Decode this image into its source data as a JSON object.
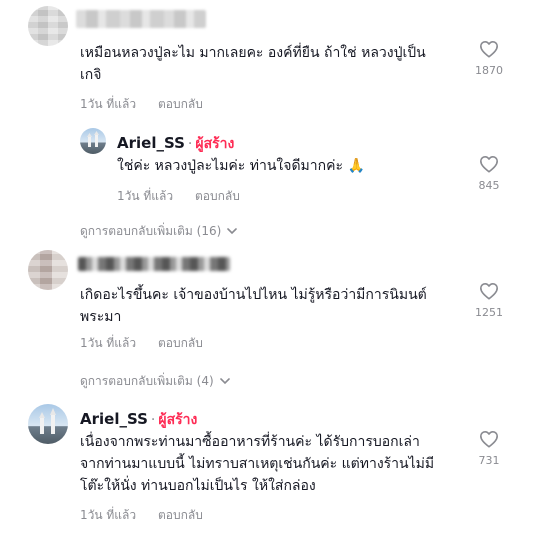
{
  "comments": [
    {
      "author": "",
      "text_lines": [
        "เหมือนหลวงปู่ละไม มากเลยคะ องค์ที่ยืน ถ้าใช่ หลวงปู่เป็น",
        "เกจิ"
      ],
      "time": "1วัน ที่แล้ว",
      "reply_label": "ตอบกลับ",
      "likes": "1870",
      "reply": {
        "author": "Ariel_SS",
        "dot": "·",
        "creator_label": "ผู้สร้าง",
        "text": "ใช่ค่ะ หลวงปู่ละไมค่ะ ท่านใจดีมากค่ะ 🙏",
        "time": "1วัน ที่แล้ว",
        "reply_label": "ตอบกลับ",
        "likes": "845"
      },
      "more_replies": "ดูการตอบกลับเพิ่มเติม (16)"
    },
    {
      "author": "",
      "text_lines": [
        "เกิดอะไรขึ้นคะ เจ้าของบ้านไปไหน ไม่รู้หรือว่ามีการนิมนต์",
        "พระมา"
      ],
      "time": "1วัน ที่แล้ว",
      "reply_label": "ตอบกลับ",
      "likes": "1251",
      "more_replies": "ดูการตอบกลับเพิ่มเติม (4)"
    },
    {
      "author": "Ariel_SS",
      "dot": "·",
      "creator_label": "ผู้สร้าง",
      "text_lines": [
        "เนื่องจากพระท่านมาซื้ออาหารที่ร้านค่ะ ได้รับการบอกเล่า",
        "จากท่านมาแบบนี้ ไม่ทราบสาเหตุเช่นกันค่ะ แต่ทางร้านไม่มี",
        "โต๊ะให้นั่ง ท่านบอกไม่เป็นไร ให้ใส่กล่อง"
      ],
      "time": "1วัน ที่แล้ว",
      "reply_label": "ตอบกลับ",
      "likes": "731"
    }
  ],
  "icons": {
    "like": "heart-outline-icon",
    "expand": "chevron-down-icon"
  },
  "colors": {
    "creator": "#fe2c55",
    "meta": "#8a8b91",
    "text": "#161823"
  }
}
